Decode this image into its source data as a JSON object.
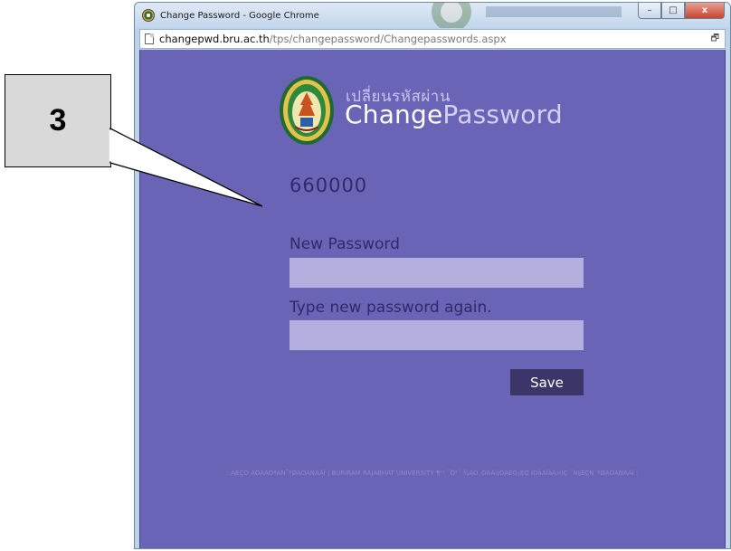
{
  "window": {
    "title": "Change Password - Google Chrome",
    "controls": {
      "minimize": "–",
      "maximize": "□",
      "close": "x"
    }
  },
  "addressbar": {
    "host": "changepwd.bru.ac.th",
    "path": "/tps/changepassword/Changepasswords.aspx"
  },
  "page": {
    "thai_title": "เปลี่ยนรหัสผ่าน",
    "title_part1": "Change",
    "title_part2": "Password",
    "username": "660000",
    "new_password_label": "New Password",
    "confirm_password_label": "Type new password again.",
    "new_password_value": "",
    "confirm_password_value": "",
    "save_label": "Save",
    "footer": ": ÁËÇÒ ÃÔÂÃÒªÀÑ¯ºØÃÕÃÑÁÂì | BURIRAM RAJABHAT UNIVERSITY ¶¹¹ ¨Ô¹´ ¾ÂÒ¸ÔÂÂì¡ÒÃÈÖ¡ÉÒ ÍÓàÀÍàÁ×ÍÇ ¨Ñ§ËÇÑ´ºØÃÕÃÑÁÂì :"
  },
  "callout": {
    "number": "3"
  },
  "colors": {
    "page_bg": "#6a64b6",
    "input_bg": "#b3b0e0",
    "button_bg": "#3b3568",
    "label_text": "#2f2a6a",
    "callout_bg": "#d9d9d9"
  },
  "icons": [
    "app-icon",
    "page-icon",
    "translate-icon",
    "university-logo"
  ]
}
